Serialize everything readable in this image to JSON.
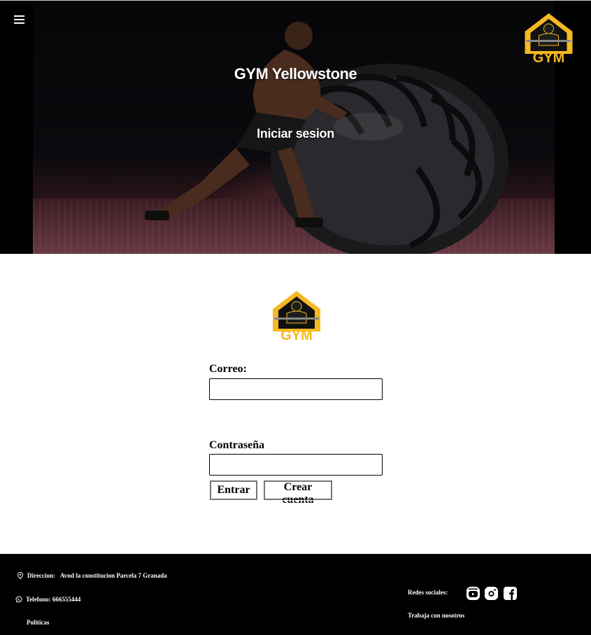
{
  "hero": {
    "title": "GYM Yellowstone",
    "subtitle": "Iniciar sesion",
    "logo_text": "GYM",
    "menu_icon": "hamburger-menu-icon"
  },
  "form": {
    "logo_text": "GYM",
    "email_label": "Correo:",
    "email_value": "",
    "password_label": "Contraseña",
    "password_value": "",
    "submit_label": "Entrar",
    "create_label": "Crear cuenta"
  },
  "footer": {
    "address_label": "Direccion:",
    "address_value": "Avnd la constitucion Parcela 7 Granada",
    "phone_text": "Telefono: 666555444",
    "policies": "Politicas",
    "social_label": "Redes sociales:",
    "work_with_us": "Trabaja con nosotros",
    "social_icons": [
      "youtube-icon",
      "instagram-icon",
      "facebook-icon"
    ]
  },
  "colors": {
    "brand_yellow": "#f5b921",
    "hero_bg": "#000000",
    "footer_bg": "#000000"
  }
}
